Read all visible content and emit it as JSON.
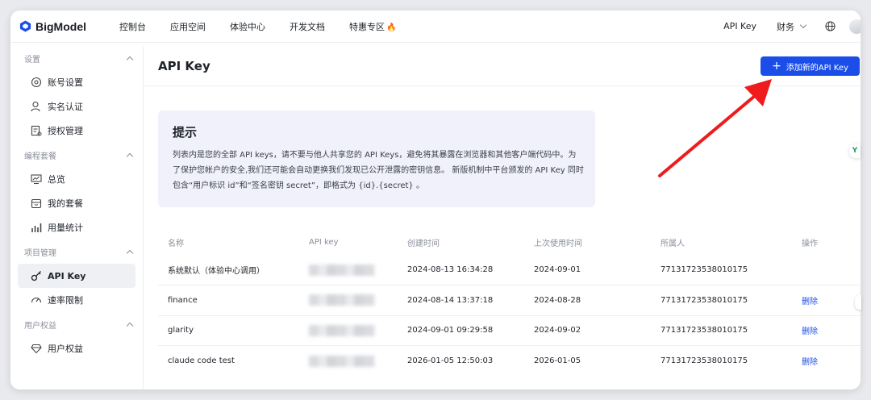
{
  "brand": {
    "name": "BigModel",
    "accent": "#1b4ee8"
  },
  "topnav": {
    "items": [
      "控制台",
      "应用空间",
      "体验中心",
      "开发文档",
      "特惠专区"
    ],
    "promo_icon": "🔥",
    "api_key": "API Key",
    "finance": "财务"
  },
  "sidebar": {
    "groups": [
      {
        "label": "设置",
        "items": [
          {
            "label": "账号设置",
            "icon": "gear-icon"
          },
          {
            "label": "实名认证",
            "icon": "user-icon"
          },
          {
            "label": "授权管理",
            "icon": "authorize-icon"
          }
        ]
      },
      {
        "label": "编程套餐",
        "items": [
          {
            "label": "总览",
            "icon": "monitor-icon"
          },
          {
            "label": "我的套餐",
            "icon": "package-icon"
          },
          {
            "label": "用量统计",
            "icon": "bar-chart-icon"
          }
        ]
      },
      {
        "label": "项目管理",
        "items": [
          {
            "label": "API Key",
            "icon": "key-icon",
            "active": true
          },
          {
            "label": "速率限制",
            "icon": "speedometer-icon"
          }
        ]
      },
      {
        "label": "用户权益",
        "items": [
          {
            "label": "用户权益",
            "icon": "diamond-icon"
          }
        ]
      }
    ]
  },
  "main": {
    "title": "API Key",
    "add_button": "添加新的API Key",
    "tip": {
      "title": "提示",
      "body": "列表内是您的全部 API keys，请不要与他人共享您的 API Keys，避免将其暴露在浏览器和其他客户端代码中。为了保护您帐户的安全,我们还可能会自动更换我们发现已公开泄露的密钥信息。 新版机制中平台颁发的 API Key 同时包含“用户标识 id”和“签名密钥 secret”，即格式为 {id}.{secret} 。"
    },
    "table": {
      "columns": [
        "名称",
        "API key",
        "创建时间",
        "上次使用时间",
        "所属人",
        "操作"
      ],
      "rows": [
        {
          "name": "系统默认（体验中心调用）",
          "created": "2024-08-13 16:34:28",
          "last_used": "2024-09-01",
          "owner": "77131723538010175",
          "action": ""
        },
        {
          "name": "finance",
          "created": "2024-08-14 13:37:18",
          "last_used": "2024-08-28",
          "owner": "77131723538010175",
          "action": "删除"
        },
        {
          "name": "glarity",
          "created": "2024-09-01 09:29:58",
          "last_used": "2024-09-02",
          "owner": "77131723538010175",
          "action": "删除"
        },
        {
          "name": "claude code test",
          "created": "2026-01-05 12:50:03",
          "last_used": "2026-01-05",
          "owner": "77131723538010175",
          "action": "删除"
        }
      ]
    }
  },
  "side_widget": {
    "label": "Y"
  },
  "colors": {
    "accent": "#1b4ee8",
    "annotation_arrow": "#ee1c1c",
    "tip_bg": "#f0f1fb"
  }
}
